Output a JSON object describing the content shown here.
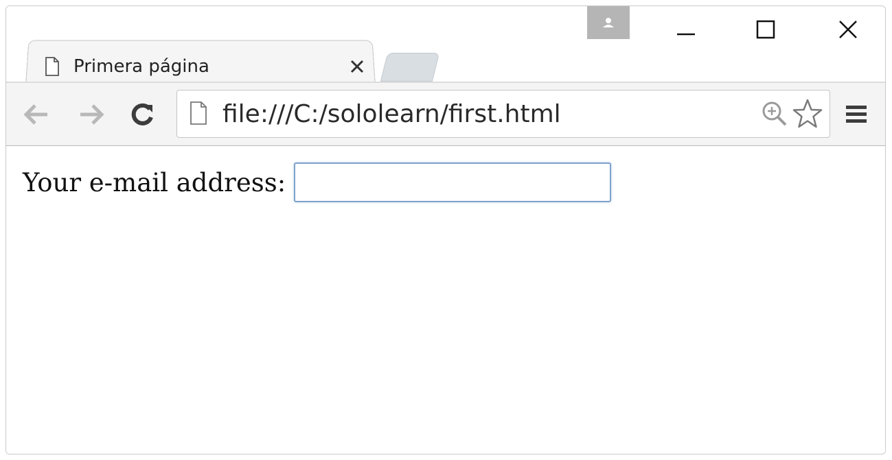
{
  "tab": {
    "title": "Primera página"
  },
  "toolbar": {
    "url": "file:///C:/sololearn/first.html"
  },
  "page": {
    "form": {
      "label": "Your e-mail address:",
      "input_value": "",
      "input_placeholder": ""
    }
  },
  "icons": {
    "tab_favicon": "page-icon",
    "tab_close": "close-icon",
    "profile": "user-icon",
    "minimize": "minimize-icon",
    "maximize": "maximize-icon",
    "close": "close-icon",
    "back": "back-arrow-icon",
    "forward": "forward-arrow-icon",
    "reload": "reload-icon",
    "omnibox_page": "page-icon",
    "zoom": "zoom-icon",
    "bookmark": "star-icon",
    "menu": "hamburger-menu-icon"
  },
  "colors": {
    "input_border": "#7ea2cc",
    "toolbar_bg": "#f4f4f4",
    "profile_bg": "#b5b5b5"
  }
}
